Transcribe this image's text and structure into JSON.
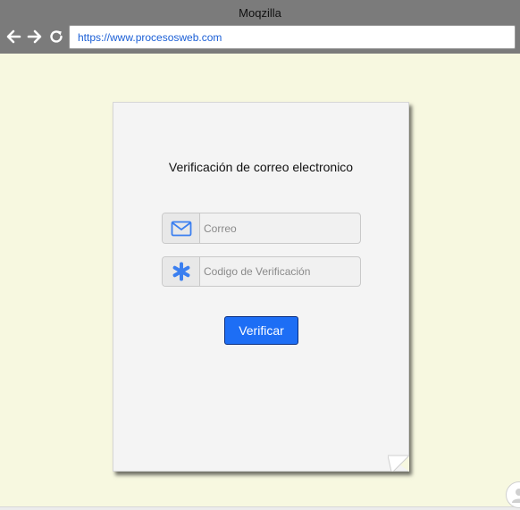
{
  "browser": {
    "title": "Moqzilla",
    "url": "https://www.procesosweb.com"
  },
  "form": {
    "title": "Verificación de correo electronico",
    "email_placeholder": "Correo",
    "code_placeholder": "Codigo de Verificación",
    "submit_label": "Verificar"
  },
  "colors": {
    "page_background": "#f7f8e0",
    "chrome": "#7b7b7b",
    "accent": "#1d6ef5",
    "icon_blue": "#3b7ff0"
  },
  "icons": {
    "back": "arrow-left-icon",
    "forward": "arrow-right-icon",
    "reload": "reload-icon",
    "email": "envelope-icon",
    "code": "asterisk-icon"
  }
}
